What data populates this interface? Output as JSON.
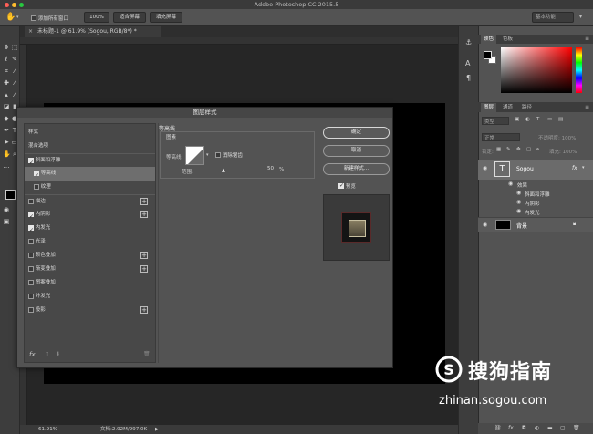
{
  "app": {
    "title": "Adobe Photoshop CC 2015.5"
  },
  "optbar": {
    "autoselect_label": "添加所有窗口",
    "zoom_btn": "100%",
    "fit_btn": "适合屏幕",
    "fill_btn": "填充屏幕",
    "workspace": "基本功能"
  },
  "document": {
    "tab_title": "未标题-1 @ 61.9% (Sogou, RGB/8*) *",
    "tab_close": "×"
  },
  "status": {
    "zoom": "61.91%",
    "docsize": "文档:2.92M/997.0K"
  },
  "panels": {
    "color_tab": "颜色",
    "swatch_tab": "色板",
    "layers_tab": "图层",
    "channels_tab": "通道",
    "paths_tab": "路径",
    "filter_label": "类型",
    "blend_mode": "正常",
    "opacity": "不透明度: 100%",
    "lock_label": "锁定:",
    "fill": "填充: 100%",
    "layers": {
      "sogou_name": "Sogou",
      "fx": "fx",
      "effects_label": "效果",
      "effect1": "斜面和浮雕",
      "effect2": "内阴影",
      "effect3": "内发光",
      "bg_name": "背景"
    }
  },
  "dialog": {
    "title": "图层样式",
    "styles_header": "样式",
    "blend_options": "混合选项",
    "items": [
      {
        "label": "斜面和浮雕",
        "checked": true
      },
      {
        "label": "等高线",
        "checked": true
      },
      {
        "label": "纹理",
        "checked": false
      },
      {
        "label": "描边",
        "checked": false
      },
      {
        "label": "内阴影",
        "checked": true
      },
      {
        "label": "内发光",
        "checked": true
      },
      {
        "label": "光泽",
        "checked": false
      },
      {
        "label": "颜色叠加",
        "checked": false
      },
      {
        "label": "渐变叠加",
        "checked": false
      },
      {
        "label": "图案叠加",
        "checked": false
      },
      {
        "label": "外发光",
        "checked": false
      },
      {
        "label": "投影",
        "checked": false
      }
    ],
    "section_title": "等高线",
    "group_title": "图素",
    "contour_label": "等高线:",
    "antialias_label": "消除锯齿",
    "range_label": "范围:",
    "range_value": "50",
    "range_unit": "%",
    "ok": "确定",
    "cancel": "取消",
    "new_style": "新建样式...",
    "preview_label": "预览",
    "fx_label": "fx"
  },
  "watermark": {
    "brand": "搜狗指南",
    "url": "zhinan.sogou.com"
  }
}
